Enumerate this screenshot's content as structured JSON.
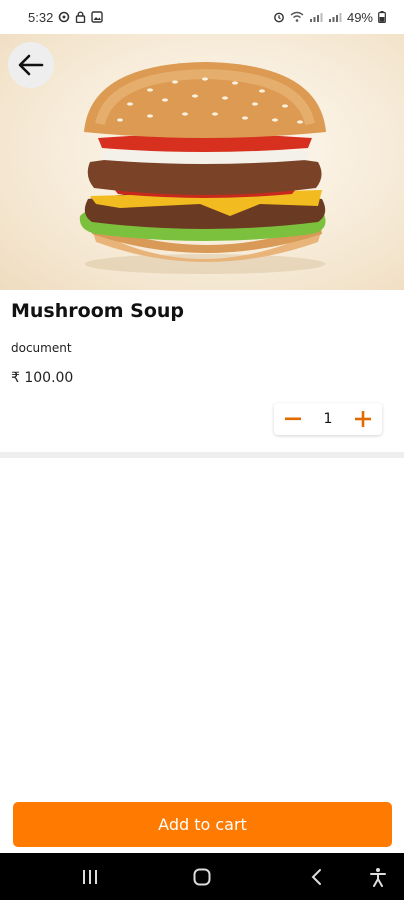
{
  "status_bar": {
    "time": "5:32",
    "battery_percent": "49%",
    "left_icons": [
      "settings-icon",
      "lock-icon",
      "gallery-icon"
    ],
    "right_icons": [
      "alarm-icon",
      "wifi-icon",
      "lte-signal-icon",
      "signal-icon",
      "battery-icon"
    ]
  },
  "product": {
    "title": "Mushroom Soup",
    "description": "document",
    "price": "₹ 100.00",
    "quantity": "1"
  },
  "actions": {
    "add_to_cart_label": "Add to cart"
  },
  "nav": {
    "buttons": [
      "recent-apps-icon",
      "home-icon",
      "back-icon",
      "accessibility-icon"
    ]
  },
  "colors": {
    "accent": "#ff7a00",
    "qty_control": "#e06a00"
  }
}
